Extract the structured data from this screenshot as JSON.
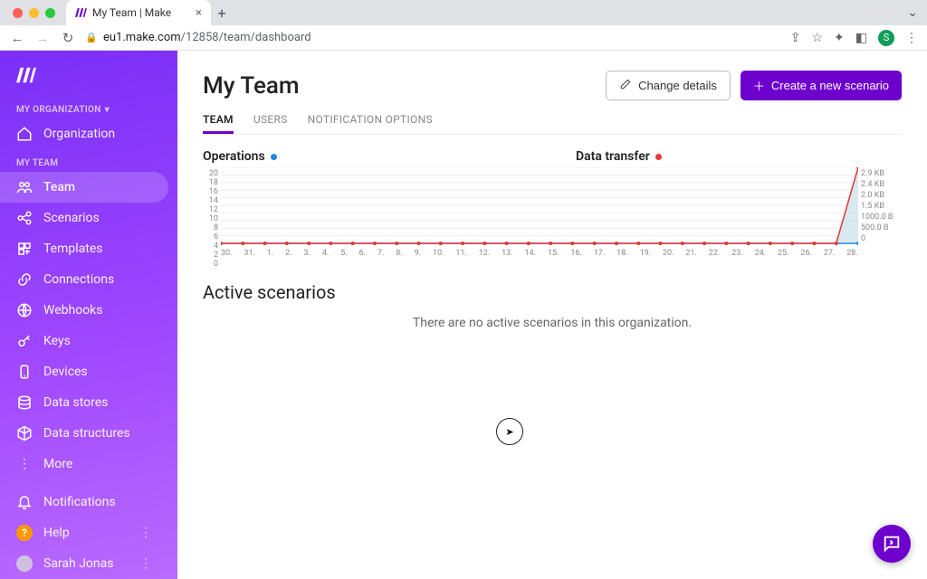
{
  "browser": {
    "tab_title": "My Team | Make",
    "url_host": "eu1.make.com",
    "url_path": "/12858/team/dashboard",
    "profile_initial": "S"
  },
  "sidebar": {
    "org_label": "MY ORGANIZATION",
    "org_item": "Organization",
    "team_label": "MY TEAM",
    "items": {
      "team": "Team",
      "scenarios": "Scenarios",
      "templates": "Templates",
      "connections": "Connections",
      "webhooks": "Webhooks",
      "keys": "Keys",
      "devices": "Devices",
      "datastores": "Data stores",
      "datastructures": "Data structures",
      "more": "More"
    },
    "footer": {
      "notifications": "Notifications",
      "help": "Help",
      "user": "Sarah Jonas"
    }
  },
  "header": {
    "title": "My Team",
    "change_details": "Change details",
    "create_scenario": "Create a new scenario"
  },
  "main_tabs": {
    "team": "TEAM",
    "users": "USERS",
    "notification_options": "NOTIFICATION OPTIONS"
  },
  "chart_head": {
    "operations": "Operations",
    "data_transfer": "Data transfer"
  },
  "active_scenarios": {
    "title": "Active scenarios",
    "empty": "There are no active scenarios in this organization."
  },
  "chart_data": {
    "type": "line",
    "x_categories": [
      "30.",
      "31.",
      "1.",
      "2.",
      "3.",
      "4.",
      "5.",
      "6.",
      "7.",
      "8.",
      "9.",
      "10.",
      "11.",
      "12.",
      "13.",
      "14.",
      "15.",
      "16.",
      "17.",
      "18.",
      "19.",
      "20.",
      "21.",
      "22.",
      "23.",
      "24.",
      "25.",
      "26.",
      "27.",
      "28."
    ],
    "series": [
      {
        "name": "Operations",
        "color": "#1e88e5",
        "values": [
          0,
          0,
          0,
          0,
          0,
          0,
          0,
          0,
          0,
          0,
          0,
          0,
          0,
          0,
          0,
          0,
          0,
          0,
          0,
          0,
          0,
          0,
          0,
          0,
          0,
          0,
          0,
          0,
          0,
          0
        ]
      },
      {
        "name": "Data transfer",
        "color": "#e53935",
        "values": [
          0,
          0,
          0,
          0,
          0,
          0,
          0,
          0,
          0,
          0,
          0,
          0,
          0,
          0,
          0,
          0,
          0,
          0,
          0,
          0,
          0,
          0,
          0,
          0,
          0,
          0,
          0,
          0,
          0,
          20
        ]
      }
    ],
    "y_left": {
      "label": "Operations",
      "ticks": [
        "20",
        "18",
        "16",
        "14",
        "12",
        "10",
        "8",
        "6",
        "4",
        "2",
        "0"
      ],
      "range": [
        0,
        20
      ]
    },
    "y_right": {
      "label": "Data transfer",
      "ticks": [
        "2.9 KB",
        "2.4 KB",
        "2.0 KB",
        "1.5 KB",
        "1000.0 B",
        "500.0 B",
        "0"
      ]
    }
  },
  "colors": {
    "primary": "#6d00cc"
  }
}
